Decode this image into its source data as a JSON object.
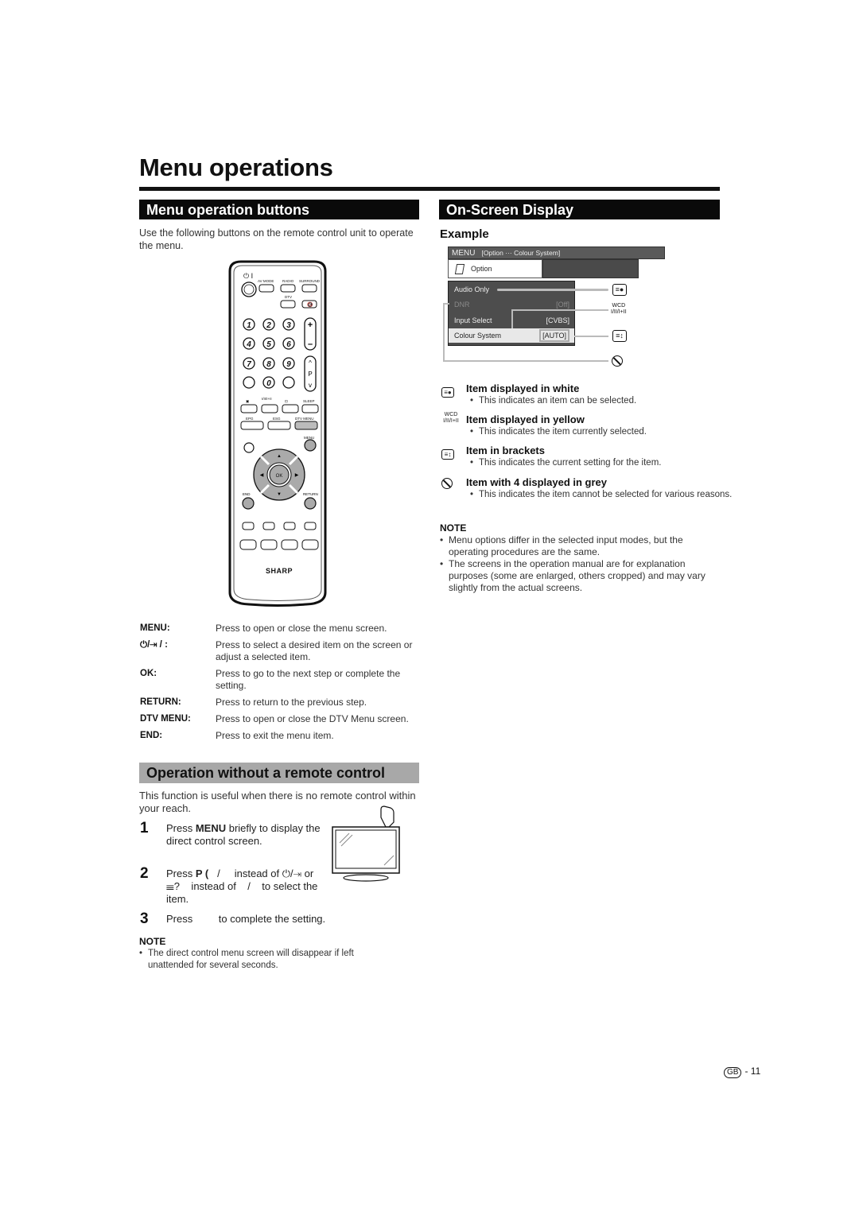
{
  "page": {
    "title": "Menu operations",
    "page_number": "- 11",
    "region_badge": "GB"
  },
  "left": {
    "section1_heading": "Menu operation buttons",
    "intro": "Use the following buttons on the remote control unit to operate the menu.",
    "remote": {
      "brand": "SHARP",
      "labels": {
        "power": "⏻ I",
        "av_mode": "AV MODE",
        "radio": "RADIO",
        "surround": "SURROUND",
        "dtv": "DTV",
        "p": "P",
        "sleep": "SLEEP",
        "epg": "EPG",
        "esg": "ESG",
        "dtv_menu": "DTV MENU",
        "menu": "MENU",
        "ok": "OK",
        "end": "END",
        "return": "RETURN",
        "audio": "I/II/I+II"
      },
      "digits": [
        "1",
        "2",
        "3",
        "4",
        "5",
        "6",
        "7",
        "8",
        "9",
        "0"
      ]
    },
    "definitions": [
      {
        "term": "MENU:",
        "desc": "Press to open or close the menu screen."
      },
      {
        "term": "⏻/⇥ / :",
        "desc": "Press to select a desired item on the screen or adjust a selected item."
      },
      {
        "term": "OK:",
        "desc": "Press to go to the next step or complete the setting."
      },
      {
        "term": "RETURN:",
        "desc": "Press to return to the previous step."
      },
      {
        "term": "DTV MENU:",
        "desc": "Press to open or close the DTV Menu screen."
      },
      {
        "term": "END:",
        "desc": "Press to exit the menu item."
      }
    ],
    "section2_heading": "Operation without a remote control",
    "section2_intro": "This function is useful when there is no remote control within your reach.",
    "steps": [
      {
        "num": "1",
        "pre": "Press ",
        "bold": "MENU",
        "post": " briefly to display the direct control screen."
      },
      {
        "num": "2",
        "pre": "Press ",
        "bold": "P (",
        "post": "   /     instead of ⏻/⇥ or          ☰?    instead of    /    to select the item."
      },
      {
        "num": "3",
        "pre": "Press ",
        "bold": "",
        "post": "        to complete the setting."
      }
    ],
    "note_heading": "NOTE",
    "notes": [
      "The direct control menu screen will disappear if left unattended for several seconds."
    ]
  },
  "right": {
    "section_heading": "On-Screen Display",
    "example_label": "Example",
    "osd": {
      "menu_label": "MENU",
      "breadcrumb": "[Option ··· Colour System]",
      "tab_label": "Option",
      "items": [
        {
          "label": "Audio Only",
          "value": "",
          "state": "white"
        },
        {
          "label": "DNR",
          "value": "[Off]",
          "state": "grey"
        },
        {
          "label": "Input Select",
          "value": "[CVBS]",
          "state": "white"
        },
        {
          "label": "Colour System",
          "value": "[AUTO]",
          "state": "selected"
        }
      ],
      "colors": {
        "bar": "#5a5a5a",
        "panel": "#4d4d4d",
        "selected": "#e8e8e8",
        "grey_text": "#8a8a8a"
      }
    },
    "legend": [
      {
        "icon": "white-item-icon",
        "heading": "Item displayed in white",
        "desc": "This indicates an item can be selected."
      },
      {
        "icon": "yellow-item-icon",
        "heading": "Item displayed in yellow",
        "desc": "This indicates the item currently selected."
      },
      {
        "icon": "brackets-icon",
        "heading": "Item in brackets",
        "desc": "This indicates the current setting for the item."
      },
      {
        "icon": "prohibited-icon",
        "heading": "Item with 4   displayed in grey",
        "desc": "This indicates the item cannot be selected for various reasons."
      }
    ],
    "note_heading": "NOTE",
    "notes": [
      "Menu options differ in the selected input modes, but the operating procedures are the same.",
      "The screens in the operation manual are for explanation purposes (some are enlarged, others cropped) and may vary slightly from the actual screens."
    ]
  }
}
